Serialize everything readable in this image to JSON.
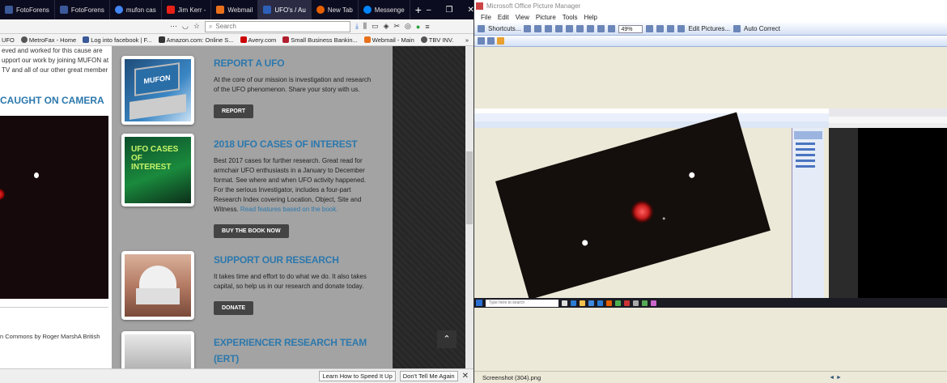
{
  "browser": {
    "tabs": [
      {
        "label": "FotoForens",
        "color": "#3b5998"
      },
      {
        "label": "FotoForens",
        "color": "#3b5998"
      },
      {
        "label": "mufon cas",
        "color": "#4285f4"
      },
      {
        "label": "Jim Kerr -",
        "color": "#e62117"
      },
      {
        "label": "Webmail",
        "color": "#e8701a"
      },
      {
        "label": "UFO's / Au",
        "color": "#2d5fb7"
      },
      {
        "label": "New Tab",
        "color": "#e66000"
      },
      {
        "label": "Messenge",
        "color": "#0084ff"
      }
    ],
    "new_tab": "+",
    "window_buttons": [
      "–",
      "❐",
      "✕"
    ],
    "url_tail": "…",
    "search_placeholder": "Search",
    "bookmarks": [
      {
        "label": "UFO",
        "color": "#777"
      },
      {
        "label": "MetroFax - Home",
        "color": "#555"
      },
      {
        "label": "Log into facebook | F...",
        "color": "#3b5998"
      },
      {
        "label": "Amazon.com: Online S...",
        "color": "#333"
      },
      {
        "label": "Avery.com",
        "color": "#cc0000"
      },
      {
        "label": "Small Business Bankin...",
        "color": "#b01e2e"
      },
      {
        "label": "Webmail - Main",
        "color": "#e8701a"
      },
      {
        "label": "TBV INV.",
        "color": "#555"
      }
    ],
    "more_bookmarks": "»"
  },
  "left_column": {
    "intro_lines": [
      "eved and worked for this cause are",
      "upport our work by joining MUFON at",
      "TV and all of our other great member"
    ],
    "caught_heading": "CAUGHT ON CAMERA",
    "caption": "n Commons by Roger MarshA British"
  },
  "sections": [
    {
      "title": "REPORT A UFO",
      "text": "At the core of our mission is investigation and research of the UFO phenomenon. Share your story with us.",
      "button": "REPORT",
      "image_label": "MUFON"
    },
    {
      "title": "2018 UFO CASES OF INTEREST",
      "text": "Best 2017 cases for further research. Great read for armchair UFO enthusiasts in a January to December format. See where and when UFO activity happened. For the serious Investigator, includes a four-part Research Index covering Location, Object, Site and Witness.",
      "link": "Read features based on the book.",
      "button": "BUY THE BOOK NOW",
      "image_label": "UFO CASES OF INTEREST"
    },
    {
      "title": "SUPPORT OUR RESEARCH",
      "text": "It takes time and effort to do what we do. It also takes capital, so help us in our research and donate today.",
      "button": "DONATE"
    },
    {
      "title": "EXPERIENCER RESEARCH TEAM",
      "title2": "(ERT)"
    }
  ],
  "notification_bar": {
    "learn_button": "Learn How to Speed It Up",
    "dont_tell_button": "Don't Tell Me Again",
    "close": "✕"
  },
  "picture_manager": {
    "title": "Microsoft Office Picture Manager",
    "menu": [
      "File",
      "Edit",
      "View",
      "Picture",
      "Tools",
      "Help"
    ],
    "toolbar": {
      "shortcuts": "Shortcuts...",
      "zoom": "49%",
      "edit_pictures": "Edit Pictures...",
      "auto_correct": "Auto Correct"
    },
    "inner_search": "Type here to search",
    "status_file": "Screenshot (304).png",
    "status_nav": "◄ ►"
  }
}
